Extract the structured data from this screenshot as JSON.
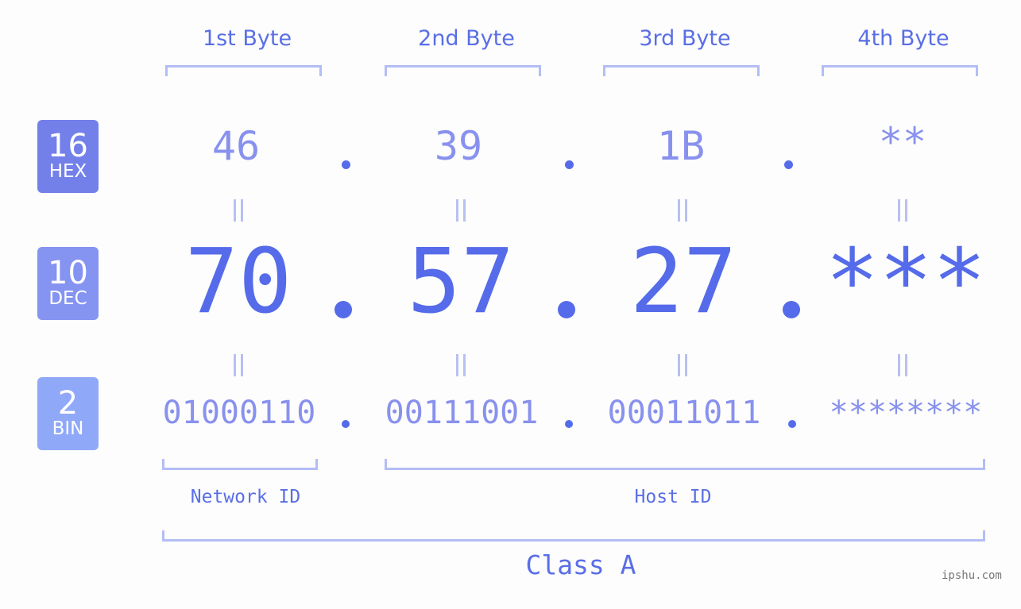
{
  "columns": [
    {
      "label": "1st Byte",
      "hex": "46",
      "dec": "70",
      "bin": "01000110"
    },
    {
      "label": "2nd Byte",
      "hex": "39",
      "dec": "57",
      "bin": "00111001"
    },
    {
      "label": "3rd Byte",
      "hex": "1B",
      "dec": "27",
      "bin": "00011011"
    },
    {
      "label": "4th Byte",
      "hex": "**",
      "dec": "***",
      "bin": "********"
    }
  ],
  "badges": [
    {
      "number": "16",
      "text": "HEX",
      "color": "#7380ea"
    },
    {
      "number": "10",
      "text": "DEC",
      "color": "#8593f1"
    },
    {
      "number": "2",
      "text": "BIN",
      "color": "#90a8f8"
    }
  ],
  "separator": ".",
  "bin_separator": ".",
  "network_id_label": "Network ID",
  "host_id_label": "Host ID",
  "class_label": "Class A",
  "watermark": "ipshu.com",
  "colors": {
    "accent": "#556bea",
    "light_value": "#8891ee",
    "bracket": "#b4bdf5"
  }
}
